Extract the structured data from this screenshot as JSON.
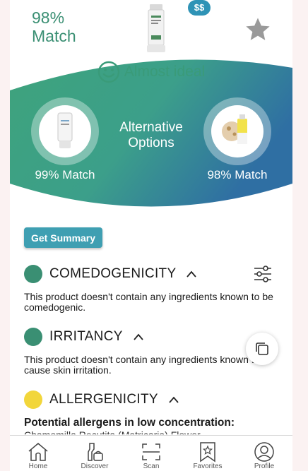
{
  "product": {
    "match": "98%\nMatch",
    "match_line1": "98%",
    "match_line2": "Match",
    "price": "$$",
    "favorite_icon": "star-icon"
  },
  "verdict": {
    "label": "Almost ideal",
    "icon": "smile-icon"
  },
  "alternatives": {
    "title_line1": "Alternative",
    "title_line2": "Options",
    "items": [
      {
        "match": "99% Match"
      },
      {
        "match": "98% Match"
      }
    ]
  },
  "summary_button": "Get Summary",
  "sections": [
    {
      "title": "COMEDOGENICITY",
      "status_color": "#3a8f73",
      "body": "This product doesn't contain any ingredients known to be comedogenic."
    },
    {
      "title": "IRRITANCY",
      "status_color": "#3a8f73",
      "body": "This product doesn't contain any ingredients known to cause skin irritation."
    },
    {
      "title": "ALLERGENICITY",
      "status_color": "#f2d63b",
      "subtitle": "Potential allergens in low concentration:",
      "ingredient": "Chamomilla Recutita (Matricaria) Flower"
    }
  ],
  "nav": [
    {
      "label": "Home",
      "icon": "home-icon"
    },
    {
      "label": "Discover",
      "icon": "discover-icon"
    },
    {
      "label": "Scan",
      "icon": "scan-icon"
    },
    {
      "label": "Favorites",
      "icon": "favorites-icon"
    },
    {
      "label": "Profile",
      "icon": "profile-icon"
    }
  ],
  "colors": {
    "accent_green": "#3a8f73",
    "accent_blue": "#2f93b6",
    "warning_yellow": "#f2d63b"
  }
}
